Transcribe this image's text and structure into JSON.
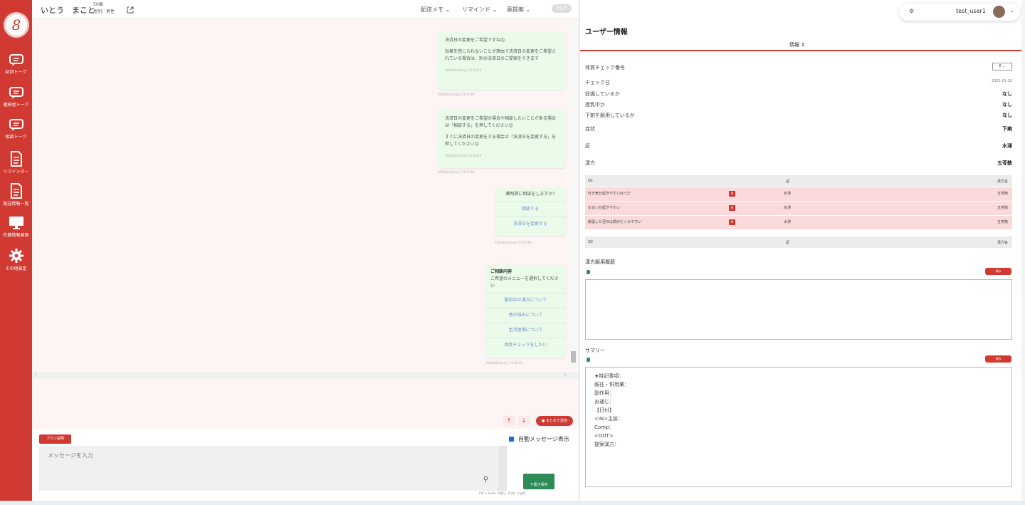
{
  "sidebar": {
    "logo": "8",
    "items": [
      {
        "label": "初回トーク",
        "icon": "chat-bubble-icon"
      },
      {
        "label": "継続者トーク",
        "icon": "chat-bubble-icon"
      },
      {
        "label": "相談トーク",
        "icon": "chat-bubble-icon"
      },
      {
        "label": "リマインダー",
        "icon": "document-icon"
      },
      {
        "label": "配送情報一覧",
        "icon": "document-icon"
      },
      {
        "label": "在籍情報画面",
        "icon": "monitor-icon"
      },
      {
        "label": "その他設定",
        "icon": "gear-icon"
      }
    ]
  },
  "header": {
    "patient_name": "いとう　まこと",
    "patient_age": "50歳",
    "patient_gender": "性別：男性",
    "dropdowns": [
      "配送メモ",
      "リマインド",
      "薬提案"
    ],
    "disabled_button": "送信済"
  },
  "chat": {
    "bubble1": {
      "line1": "決済日の変更をご希望ですね😊",
      "line2": "効果を感じられないことが理由で決済日の変更をご希望されている場合は、別の決済日のご提案をできます",
      "time": "2022年02月xx日 11:53:49"
    },
    "ts1": "2022年02月xx日 11:53:49",
    "bubble2": {
      "line1": "決済日の変更をご希望の場合や相談したいことがある場合は「相談する」を押してください😊",
      "line2": "すぐに決済日の変更をする場合は「決済日を変更する」を押してください😊",
      "time": "2022年02月xx日 11:53:49"
    },
    "ts2": "2022年02月xx日 11:53:49",
    "question": {
      "title": "薬剤師に相談をしますか?",
      "options": [
        "相談する",
        "決済日を変更する"
      ]
    },
    "ts3": "2022年02月xx日 11:53:49",
    "menu": {
      "title": "ご相談内容",
      "subtitle": "ご希望のメニューを選択してください",
      "options": [
        "服用中の漢方について",
        "他の悩みについて",
        "生活習慣について",
        "体質チェックをしたい"
      ]
    },
    "ts4": "2022年02月xx日 11:54:11",
    "bulk_send": "まとめて送信"
  },
  "input": {
    "plan_button": "プラン説明",
    "auto_message": "自動メッセージ表示",
    "placeholder": "メッセージを入力",
    "send_button": "下書き保存",
    "hint": "Ctrl + Enter で改行、Enter で送信"
  },
  "panel": {
    "user": "test_user1",
    "title": "ユーザー情報",
    "tab": "情報",
    "check_number_label": "体質チェック番号",
    "check_number_value": "6",
    "rows": [
      {
        "label": "チェック日",
        "value": "2022-01-20"
      },
      {
        "label": "妊娠しているか",
        "value": "なし"
      },
      {
        "label": "授乳中か",
        "value": "なし"
      },
      {
        "label": "下剤を服用しているか",
        "value": "なし"
      },
      {
        "label": "症状",
        "value": "下痢"
      },
      {
        "label": "証",
        "value": "水滞"
      },
      {
        "label": "漢方",
        "value": "五苓散"
      }
    ],
    "q1": {
      "headers": [
        "Q1",
        "証",
        "漢方名"
      ],
      "rows": [
        {
          "question": "吐き気が起きやすいほうだ",
          "badge": "N",
          "sho": "水滞",
          "kampo": "五苓散"
        },
        {
          "question": "めまいが起きやすい",
          "badge": "N",
          "sho": "水滞",
          "kampo": "五苓散"
        },
        {
          "question": "飲酒した翌日は顔がむくみやすい",
          "badge": "N",
          "sho": "水滞",
          "kampo": "五苓散"
        }
      ]
    },
    "q2": {
      "headers": [
        "Q2",
        "証",
        "漢方名"
      ]
    },
    "history_title": "漢方服用履歴",
    "summary_title": "サマリー",
    "save_label": "保存",
    "summary_lines": [
      "★特記事項：",
      "既往・併用薬：",
      "副作用：",
      "お通じ：",
      "【日付】",
      "<IN>主訴：",
      "Comp：",
      "<OUT>",
      "提案漢方："
    ]
  }
}
